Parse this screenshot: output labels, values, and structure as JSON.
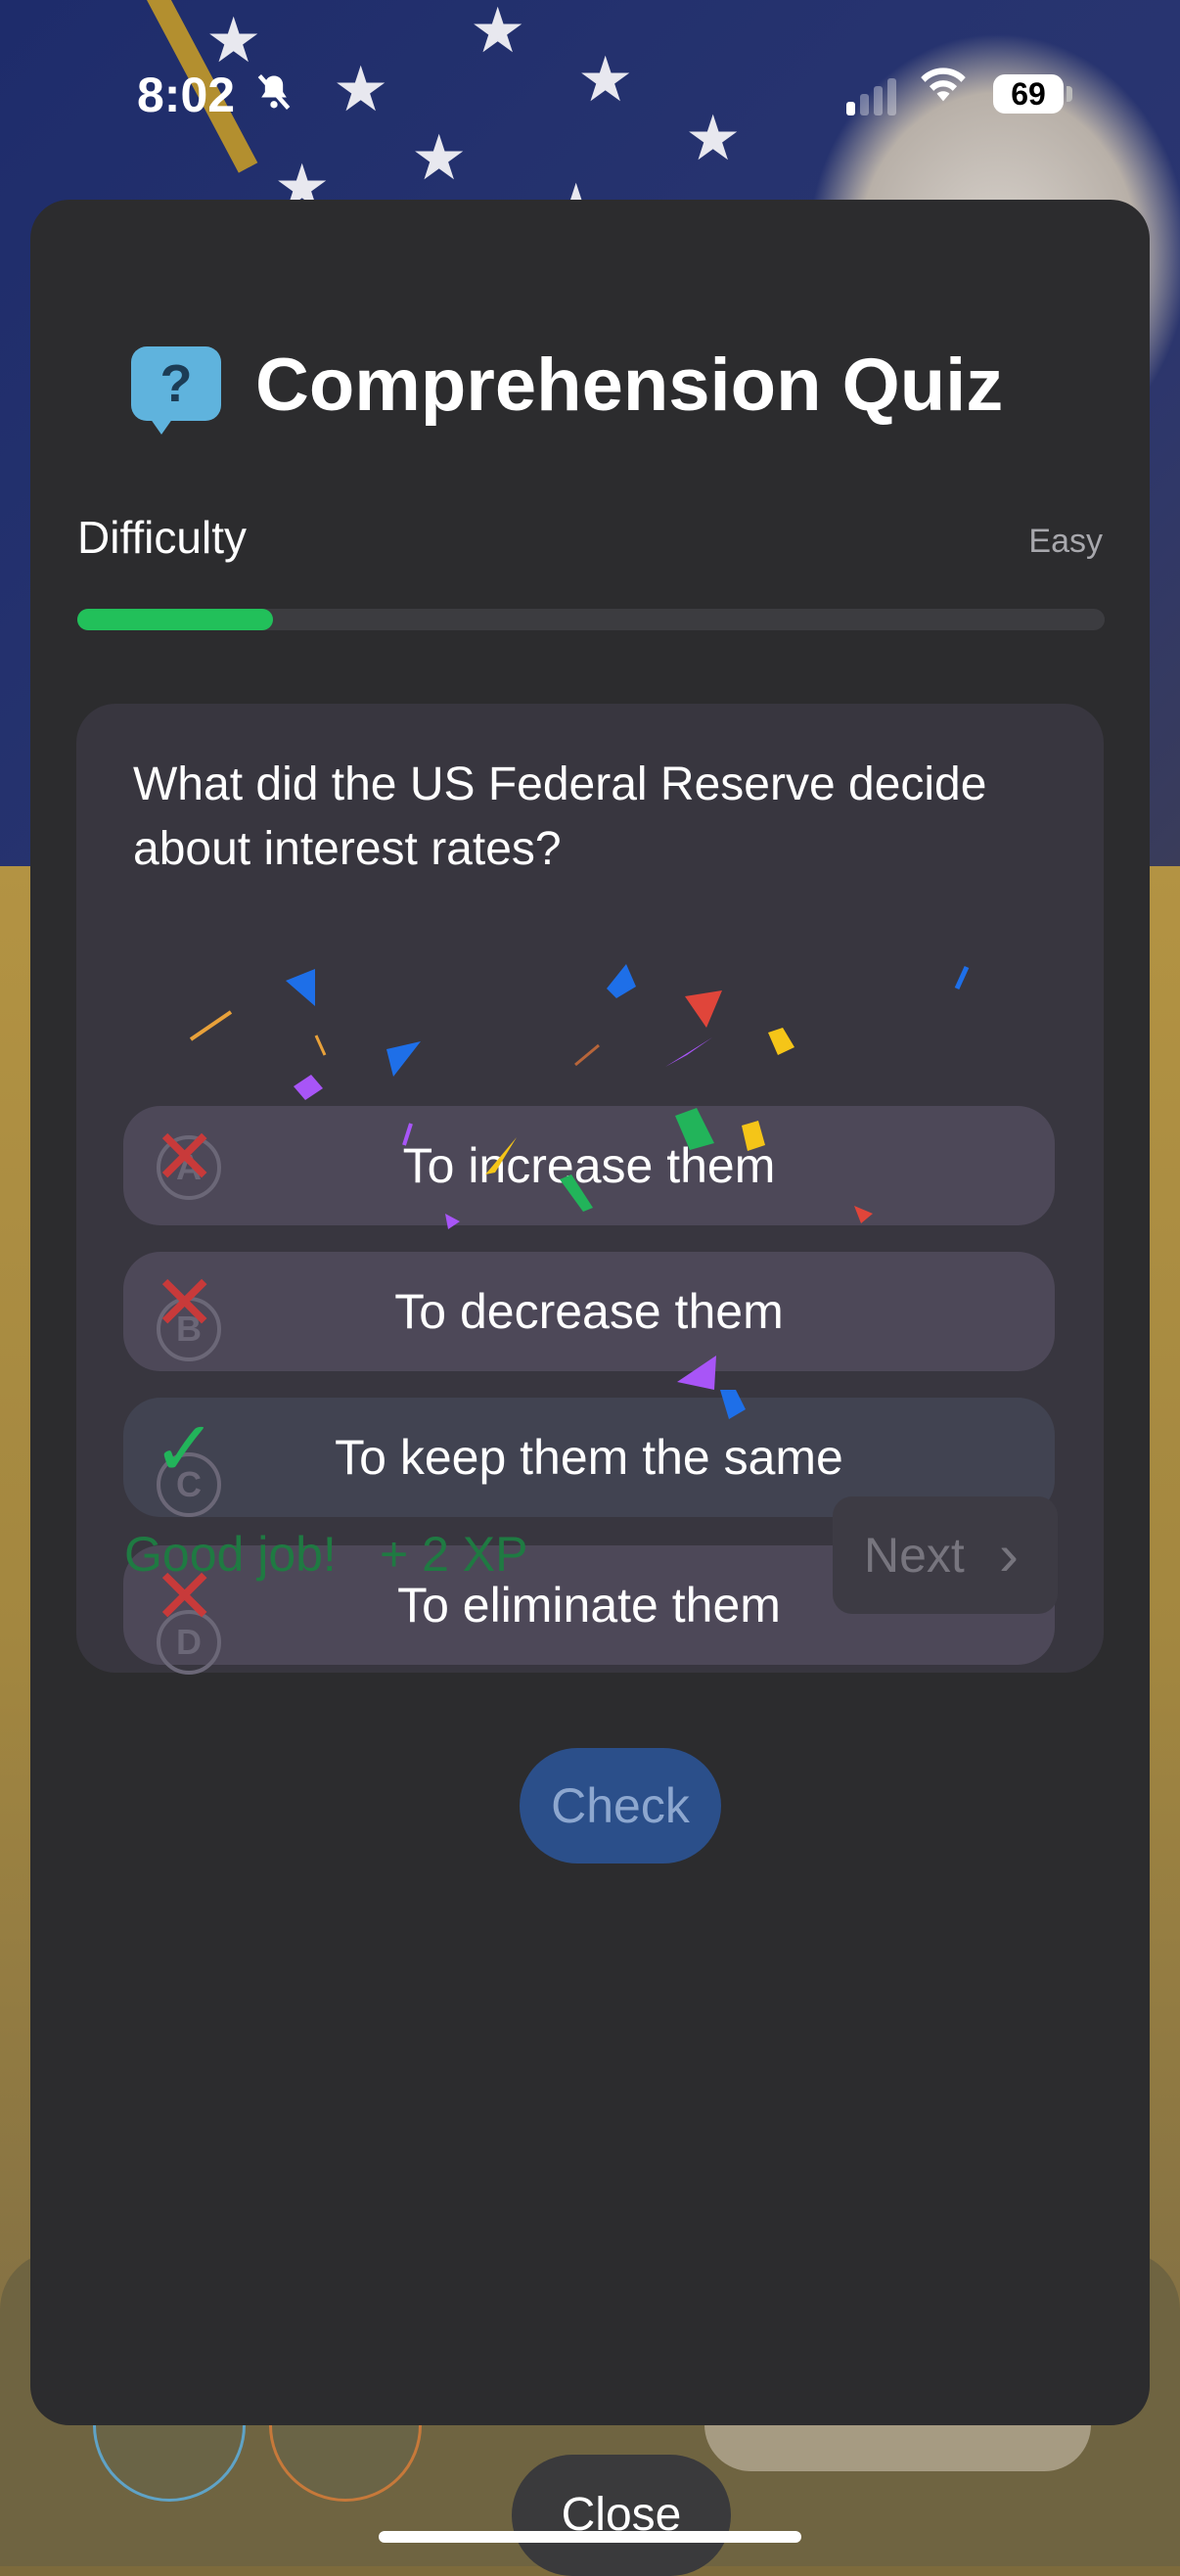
{
  "status_bar": {
    "time": "8:02",
    "battery": "69"
  },
  "quiz": {
    "title": "Comprehension Quiz",
    "icon_glyph": "?",
    "difficulty_label": "Difficulty",
    "difficulty_value": "Easy",
    "difficulty_progress": 0.19,
    "question": "What did the US Federal Reserve decide about interest rates?",
    "options": [
      {
        "letter": "A",
        "text": "To increase them",
        "result": "incorrect"
      },
      {
        "letter": "B",
        "text": "To decrease them",
        "result": "incorrect"
      },
      {
        "letter": "C",
        "text": "To keep them the same",
        "result": "correct"
      },
      {
        "letter": "D",
        "text": "To eliminate them",
        "result": "incorrect"
      }
    ],
    "feedback": "Good job!",
    "xp": "+ 2 XP",
    "next_label": "Next",
    "check_label": "Check",
    "close_label": "Close"
  },
  "colors": {
    "accent_green": "#22c05a",
    "incorrect_red": "#c83a3a",
    "check_blue": "#2b4f8a",
    "modal_bg": "#2c2c2e"
  },
  "icons": {
    "bell": "bell-slash-icon",
    "signal": "cellular-signal-icon",
    "wifi": "wifi-icon",
    "battery": "battery-icon",
    "question": "question-bubble-icon",
    "incorrect": "x-mark-icon",
    "correct": "check-mark-icon",
    "next": "chevron-right-icon"
  }
}
